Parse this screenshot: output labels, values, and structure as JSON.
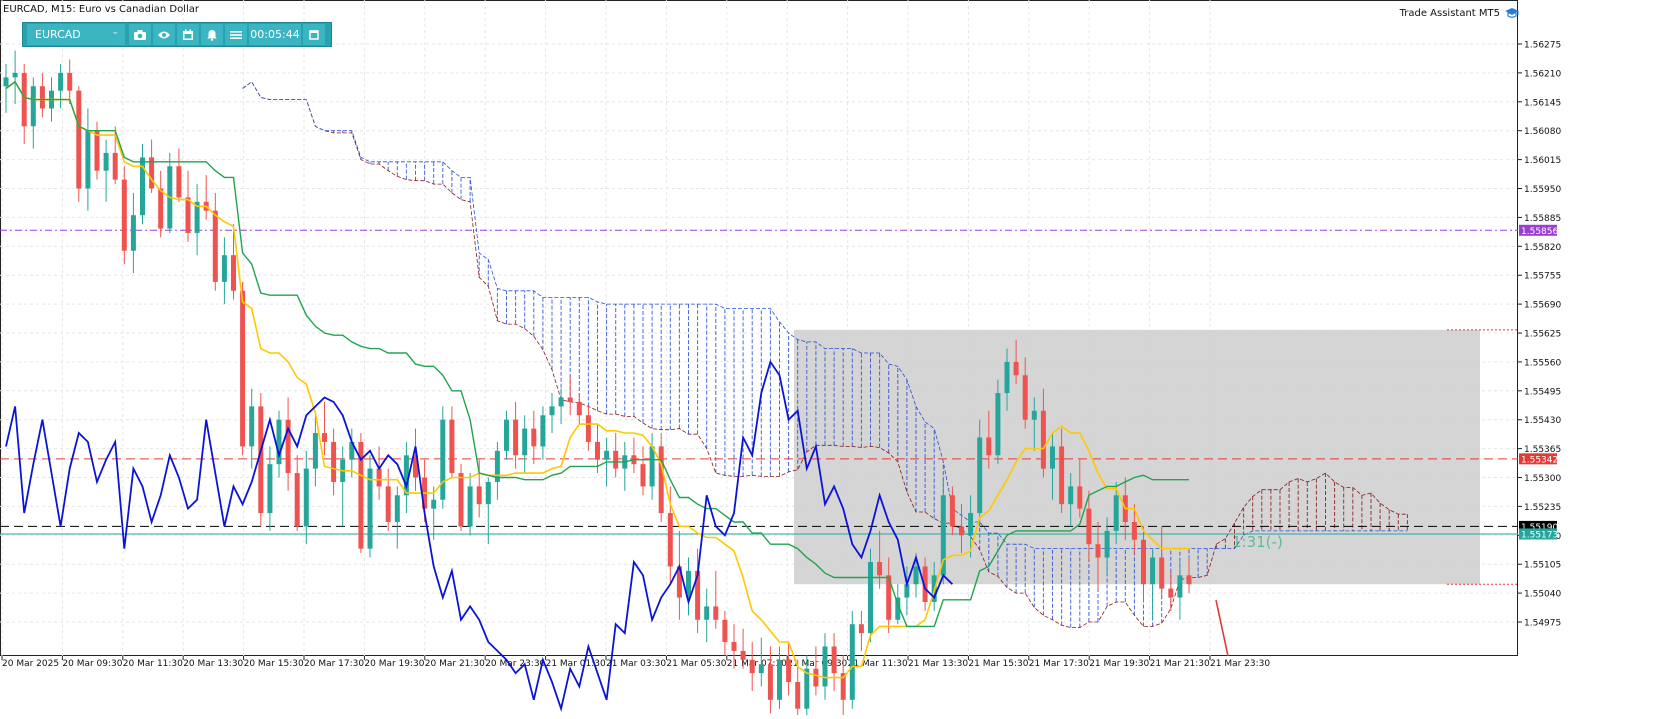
{
  "header": {
    "symbol_title": "EURCAD, M15:  Euro vs Canadian Dollar"
  },
  "toolbar": {
    "symbol": "EURCAD",
    "timer": "00:05:44",
    "icons": [
      "camera-icon",
      "eye-icon",
      "calendar-icon",
      "bell-icon",
      "menu-icon",
      "window-icon"
    ]
  },
  "trade_assistant": {
    "label": "Trade Assistant MT5",
    "icon": "graduation-cap-icon"
  },
  "price_axis": {
    "ticks": [
      "1.56275",
      "1.56210",
      "1.56145",
      "1.56080",
      "1.56015",
      "1.55950",
      "1.55885",
      "1.55820",
      "1.55755",
      "1.55690",
      "1.55625",
      "1.55560",
      "1.55495",
      "1.55430",
      "1.55365",
      "1.55300",
      "1.55235",
      "1.55170",
      "1.55105",
      "1.55040",
      "1.54975"
    ],
    "tags": [
      {
        "text": "1.55856",
        "value": 1.55856,
        "color": "#9b3fd2"
      },
      {
        "text": "1.55342",
        "value": 1.55342,
        "color": "#e53935"
      },
      {
        "text": "1.55190",
        "value": 1.5519,
        "color": "#000000"
      },
      {
        "text": "1.55173",
        "value": 1.55173,
        "color": "#26a69a"
      }
    ]
  },
  "time_axis": [
    "20 Mar 2025",
    "20 Mar 09:30",
    "20 Mar 11:30",
    "20 Mar 13:30",
    "20 Mar 15:30",
    "20 Mar 17:30",
    "20 Mar 19:30",
    "20 Mar 21:30",
    "20 Mar 23:30",
    "21 Mar 01:30",
    "21 Mar 03:30",
    "21 Mar 05:30",
    "21 Mar 07:30",
    "21 Mar 09:30",
    "21 Mar 11:30",
    "21 Mar 13:30",
    "21 Mar 15:30",
    "21 Mar 17:30",
    "21 Mar 19:30",
    "21 Mar 21:30",
    "21 Mar 23:30"
  ],
  "levels": {
    "purple": 1.55856,
    "red": 1.55342,
    "black": 1.5519,
    "teal": 1.55173
  },
  "trade_box": {
    "label": "1:31(-)",
    "top": 1.55632,
    "bottom": 1.5506
  },
  "colors": {
    "up": "#26a69a",
    "down": "#ef5350",
    "tenkan": "#ffc800",
    "kijun": "#22a350",
    "chikou": "#0b14d6",
    "kumo_bull": "#8b1a1a",
    "kumo_bear": "#2a4fd6",
    "box": "#d3d3d3"
  },
  "chart_data": {
    "type": "candlestick",
    "title": "EURCAD, M15:  Euro vs Canadian Dollar",
    "ylim": [
      1.5492,
      1.5633
    ],
    "ohlc": [
      [
        1.5618,
        1.5623,
        1.5612,
        1.562
      ],
      [
        1.562,
        1.5626,
        1.5614,
        1.5621
      ],
      [
        1.5621,
        1.5623,
        1.5605,
        1.5609
      ],
      [
        1.5609,
        1.562,
        1.5604,
        1.5618
      ],
      [
        1.5618,
        1.5621,
        1.5611,
        1.5613
      ],
      [
        1.5613,
        1.562,
        1.561,
        1.5617
      ],
      [
        1.5617,
        1.5623,
        1.5613,
        1.5621
      ],
      [
        1.5621,
        1.5624,
        1.5614,
        1.5617
      ],
      [
        1.5617,
        1.5618,
        1.5592,
        1.5595
      ],
      [
        1.5595,
        1.5613,
        1.559,
        1.5608
      ],
      [
        1.5608,
        1.561,
        1.5597,
        1.5599
      ],
      [
        1.5599,
        1.5606,
        1.5592,
        1.5603
      ],
      [
        1.5603,
        1.5609,
        1.5596,
        1.5597
      ],
      [
        1.5597,
        1.56,
        1.5578,
        1.5581
      ],
      [
        1.5581,
        1.5594,
        1.5576,
        1.5589
      ],
      [
        1.5589,
        1.5605,
        1.5587,
        1.5602
      ],
      [
        1.5602,
        1.5606,
        1.5594,
        1.5595
      ],
      [
        1.5595,
        1.5599,
        1.5584,
        1.5586
      ],
      [
        1.5586,
        1.5603,
        1.5585,
        1.56
      ],
      [
        1.56,
        1.5604,
        1.5592,
        1.5593
      ],
      [
        1.5593,
        1.5599,
        1.5583,
        1.5585
      ],
      [
        1.5585,
        1.5596,
        1.558,
        1.5592
      ],
      [
        1.5592,
        1.5598,
        1.5588,
        1.559
      ],
      [
        1.559,
        1.5594,
        1.5572,
        1.5574
      ],
      [
        1.5574,
        1.5584,
        1.5569,
        1.558
      ],
      [
        1.558,
        1.5587,
        1.557,
        1.5572
      ],
      [
        1.5572,
        1.5574,
        1.5535,
        1.5537
      ],
      [
        1.5537,
        1.555,
        1.5532,
        1.5546
      ],
      [
        1.5546,
        1.5549,
        1.5519,
        1.5522
      ],
      [
        1.5522,
        1.5537,
        1.5518,
        1.5533
      ],
      [
        1.5533,
        1.5545,
        1.553,
        1.5543
      ],
      [
        1.5543,
        1.5548,
        1.5527,
        1.5531
      ],
      [
        1.5531,
        1.5535,
        1.5518,
        1.5519
      ],
      [
        1.5519,
        1.5536,
        1.5515,
        1.5532
      ],
      [
        1.5532,
        1.5544,
        1.5528,
        1.554
      ],
      [
        1.554,
        1.5547,
        1.5535,
        1.5538
      ],
      [
        1.5538,
        1.5541,
        1.5526,
        1.5529
      ],
      [
        1.5529,
        1.5537,
        1.5519,
        1.5534
      ],
      [
        1.5534,
        1.5541,
        1.553,
        1.5538
      ],
      [
        1.5538,
        1.554,
        1.5513,
        1.5514
      ],
      [
        1.5514,
        1.5535,
        1.5512,
        1.5532
      ],
      [
        1.5532,
        1.5537,
        1.5525,
        1.5528
      ],
      [
        1.5528,
        1.5532,
        1.5518,
        1.552
      ],
      [
        1.552,
        1.5528,
        1.5514,
        1.5526
      ],
      [
        1.5526,
        1.5538,
        1.5522,
        1.5535
      ],
      [
        1.5535,
        1.5541,
        1.5527,
        1.553
      ],
      [
        1.553,
        1.5534,
        1.552,
        1.5523
      ],
      [
        1.5523,
        1.5528,
        1.5516,
        1.5525
      ],
      [
        1.5525,
        1.5546,
        1.5523,
        1.5543
      ],
      [
        1.5543,
        1.5546,
        1.553,
        1.5531
      ],
      [
        1.5531,
        1.5533,
        1.5518,
        1.5519
      ],
      [
        1.5519,
        1.5531,
        1.5517,
        1.5528
      ],
      [
        1.5528,
        1.5534,
        1.5521,
        1.5524
      ],
      [
        1.5524,
        1.553,
        1.5515,
        1.5529
      ],
      [
        1.5529,
        1.5538,
        1.5525,
        1.5536
      ],
      [
        1.5536,
        1.5545,
        1.5534,
        1.5543
      ],
      [
        1.5543,
        1.5547,
        1.5532,
        1.5535
      ],
      [
        1.5535,
        1.5544,
        1.5531,
        1.5541
      ],
      [
        1.5541,
        1.5545,
        1.5533,
        1.5537
      ],
      [
        1.5537,
        1.5546,
        1.5534,
        1.5544
      ],
      [
        1.5544,
        1.5549,
        1.554,
        1.5546
      ],
      [
        1.5546,
        1.555,
        1.5542,
        1.5548
      ],
      [
        1.5548,
        1.5553,
        1.5544,
        1.5547
      ],
      [
        1.5547,
        1.5549,
        1.5542,
        1.5544
      ],
      [
        1.5544,
        1.5546,
        1.5536,
        1.5538
      ],
      [
        1.5538,
        1.5542,
        1.5531,
        1.5534
      ],
      [
        1.5534,
        1.5539,
        1.5528,
        1.5536
      ],
      [
        1.5536,
        1.554,
        1.553,
        1.5532
      ],
      [
        1.5532,
        1.5538,
        1.5527,
        1.5535
      ],
      [
        1.5535,
        1.5539,
        1.5531,
        1.5533
      ],
      [
        1.5533,
        1.5537,
        1.5526,
        1.5528
      ],
      [
        1.5528,
        1.554,
        1.5525,
        1.5537
      ],
      [
        1.5537,
        1.554,
        1.552,
        1.5522
      ],
      [
        1.5522,
        1.5528,
        1.5506,
        1.551
      ],
      [
        1.551,
        1.5518,
        1.5498,
        1.5503
      ],
      [
        1.5503,
        1.5512,
        1.5499,
        1.5509
      ],
      [
        1.5509,
        1.5514,
        1.5495,
        1.5498
      ],
      [
        1.5498,
        1.5505,
        1.5493,
        1.5501
      ],
      [
        1.5501,
        1.5509,
        1.5496,
        1.5498
      ],
      [
        1.5498,
        1.55,
        1.549,
        1.5493
      ],
      [
        1.5493,
        1.5497,
        1.5487,
        1.5491
      ],
      [
        1.5491,
        1.5496,
        1.5487,
        1.5489
      ],
      [
        1.5489,
        1.5493,
        1.5482,
        1.5486
      ],
      [
        1.5486,
        1.5494,
        1.5483,
        1.5488
      ],
      [
        1.5488,
        1.5492,
        1.5477,
        1.548
      ],
      [
        1.548,
        1.5492,
        1.5478,
        1.5489
      ],
      [
        1.5489,
        1.5493,
        1.5481,
        1.5484
      ],
      [
        1.5484,
        1.5489,
        1.5475,
        1.5478
      ],
      [
        1.5478,
        1.549,
        1.5476,
        1.5487
      ],
      [
        1.5487,
        1.5492,
        1.5481,
        1.5483
      ],
      [
        1.5483,
        1.5495,
        1.548,
        1.5492
      ],
      [
        1.5492,
        1.5495,
        1.5482,
        1.5486
      ],
      [
        1.5486,
        1.549,
        1.5475,
        1.548
      ],
      [
        1.548,
        1.55,
        1.5478,
        1.5497
      ],
      [
        1.5497,
        1.55,
        1.5491,
        1.5495
      ],
      [
        1.5495,
        1.5514,
        1.5493,
        1.5511
      ],
      [
        1.5511,
        1.5518,
        1.5505,
        1.5508
      ],
      [
        1.5508,
        1.5512,
        1.5495,
        1.5498
      ],
      [
        1.5498,
        1.5506,
        1.5497,
        1.5503
      ],
      [
        1.5503,
        1.551,
        1.5499,
        1.5506
      ],
      [
        1.5506,
        1.5513,
        1.5503,
        1.551
      ],
      [
        1.551,
        1.5512,
        1.55,
        1.5502
      ],
      [
        1.5502,
        1.5511,
        1.55,
        1.5508
      ],
      [
        1.5508,
        1.553,
        1.5506,
        1.5526
      ],
      [
        1.5526,
        1.5528,
        1.5517,
        1.5519
      ],
      [
        1.5519,
        1.5524,
        1.5513,
        1.5517
      ],
      [
        1.5517,
        1.5526,
        1.5512,
        1.5522
      ],
      [
        1.5522,
        1.5543,
        1.5519,
        1.5539
      ],
      [
        1.5539,
        1.5545,
        1.5532,
        1.5535
      ],
      [
        1.5535,
        1.5552,
        1.5533,
        1.5549
      ],
      [
        1.5549,
        1.5559,
        1.5545,
        1.5556
      ],
      [
        1.5556,
        1.5561,
        1.5551,
        1.5553
      ],
      [
        1.5553,
        1.5557,
        1.5541,
        1.5543
      ],
      [
        1.5543,
        1.5548,
        1.5536,
        1.5545
      ],
      [
        1.5545,
        1.555,
        1.553,
        1.5532
      ],
      [
        1.5532,
        1.554,
        1.5525,
        1.5537
      ],
      [
        1.5537,
        1.5541,
        1.5522,
        1.5524
      ],
      [
        1.5524,
        1.5531,
        1.5519,
        1.5528
      ],
      [
        1.5528,
        1.5534,
        1.5521,
        1.5523
      ],
      [
        1.5523,
        1.5527,
        1.5511,
        1.5515
      ],
      [
        1.5515,
        1.552,
        1.5505,
        1.5512
      ],
      [
        1.5512,
        1.5521,
        1.5508,
        1.5518
      ],
      [
        1.5518,
        1.5529,
        1.5515,
        1.5526
      ],
      [
        1.5526,
        1.553,
        1.5516,
        1.552
      ],
      [
        1.552,
        1.5524,
        1.5513,
        1.5516
      ],
      [
        1.5516,
        1.5519,
        1.5502,
        1.5506
      ],
      [
        1.5506,
        1.5514,
        1.5498,
        1.5512
      ],
      [
        1.5512,
        1.5519,
        1.5503,
        1.5505
      ],
      [
        1.5505,
        1.5509,
        1.55,
        1.5503
      ],
      [
        1.5503,
        1.5511,
        1.5498,
        1.5508
      ],
      [
        1.5508,
        1.5512,
        1.5504,
        1.5506
      ]
    ]
  }
}
